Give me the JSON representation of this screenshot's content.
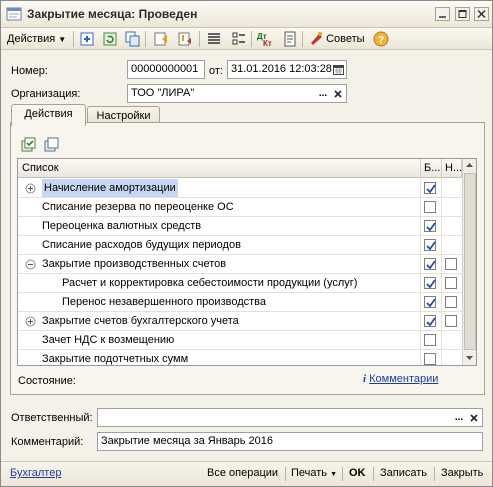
{
  "window": {
    "title": "Закрытие месяца: Проведен"
  },
  "toolbar": {
    "actions_label": "Действия",
    "advice_label": "Советы"
  },
  "form": {
    "number_label": "Номер:",
    "number_value": "00000000001",
    "from_label": "от:",
    "date_value": "31.01.2016 12:03:28",
    "org_label": "Организация:",
    "org_value": "ТОО \"ЛИРА\"",
    "ellipsis": "...",
    "responsible_label": "Ответственный:",
    "responsible_value": "",
    "comment_label": "Комментарий:",
    "comment_value": "Закрытие месяца за Январь 2016"
  },
  "tabs": [
    {
      "label": "Действия",
      "active": true
    },
    {
      "label": "Настройки",
      "active": false
    }
  ],
  "grid": {
    "columns": {
      "list": "Список",
      "col_b": "Б...",
      "col_n": "Н..."
    },
    "rows": [
      {
        "label": "Начисление амортизации",
        "level": 0,
        "expand": "plus",
        "selected": true,
        "b": true,
        "n": null
      },
      {
        "label": "Списание резерва по переоценке ОС",
        "level": 0,
        "expand": null,
        "selected": false,
        "b": false,
        "n": null
      },
      {
        "label": "Переоценка валютных средств",
        "level": 0,
        "expand": null,
        "selected": false,
        "b": true,
        "n": null
      },
      {
        "label": "Списание расходов будущих периодов",
        "level": 0,
        "expand": null,
        "selected": false,
        "b": true,
        "n": null
      },
      {
        "label": "Закрытие производственных счетов",
        "level": 0,
        "expand": "minus",
        "selected": false,
        "b": true,
        "n": false
      },
      {
        "label": "Расчет и корректировка себестоимости продукции (услуг)",
        "level": 1,
        "expand": null,
        "selected": false,
        "b": true,
        "n": false
      },
      {
        "label": "Перенос незавершенного производства",
        "level": 1,
        "expand": null,
        "selected": false,
        "b": true,
        "n": false
      },
      {
        "label": "Закрытие счетов бухгалтерского учета",
        "level": 0,
        "expand": "plus",
        "selected": false,
        "b": true,
        "n": false
      },
      {
        "label": "Зачет НДС к возмещению",
        "level": 0,
        "expand": null,
        "selected": false,
        "b": false,
        "n": null
      },
      {
        "label": "Закрытие подотчетных сумм",
        "level": 0,
        "expand": null,
        "selected": false,
        "b": false,
        "n": null
      }
    ]
  },
  "status": {
    "state_label": "Состояние:",
    "comments_link": "Комментарии"
  },
  "footer": {
    "user": "Бухгалтер",
    "all_ops": "Все операции",
    "print": "Печать",
    "ok": "OK",
    "save": "Записать",
    "close": "Закрыть"
  },
  "colors": {
    "selection": "#c7d6f2",
    "link": "#1a3e9e",
    "check": "#1f4fa0"
  }
}
